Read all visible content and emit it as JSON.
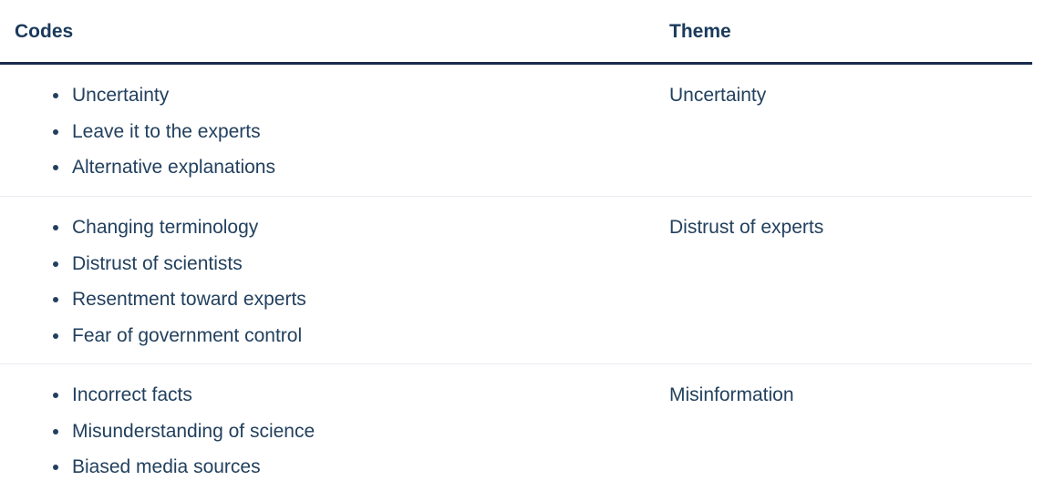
{
  "table": {
    "headers": {
      "codes": "Codes",
      "theme": "Theme"
    },
    "rows": [
      {
        "codes": [
          "Uncertainty",
          "Leave it to the experts",
          "Alternative explanations"
        ],
        "theme": "Uncertainty"
      },
      {
        "codes": [
          "Changing terminology",
          "Distrust of scientists",
          "Resentment toward experts",
          "Fear of government control"
        ],
        "theme": "Distrust of experts"
      },
      {
        "codes": [
          "Incorrect facts",
          "Misunderstanding of science",
          "Biased media sources"
        ],
        "theme": "Misinformation"
      }
    ]
  },
  "colors": {
    "text": "#22405e",
    "header_text": "#1a3a5c",
    "header_rule": "#1a2a4f",
    "row_divider": "#e8ebef"
  }
}
